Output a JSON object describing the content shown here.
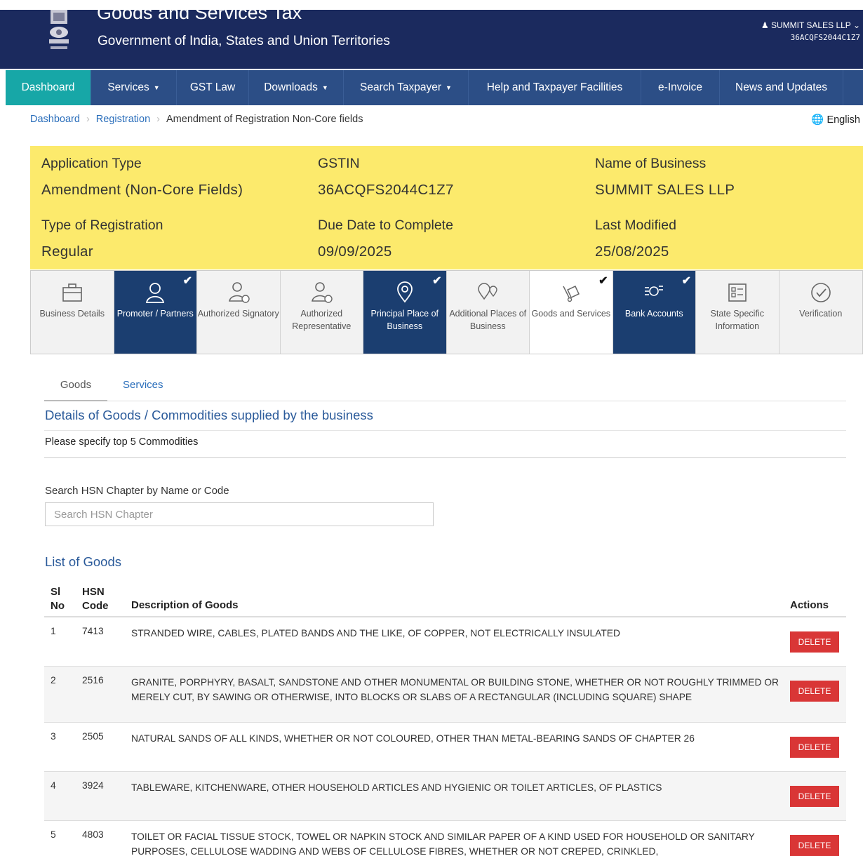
{
  "header": {
    "title": "Goods and Services Tax",
    "subtitle": "Government of India, States and Union Territories",
    "user_name": "SUMMIT SALES LLP",
    "user_gstin": "36ACQFS2044C1Z7"
  },
  "nav": [
    {
      "label": "Dashboard",
      "active": true,
      "dropdown": false
    },
    {
      "label": "Services",
      "active": false,
      "dropdown": true
    },
    {
      "label": "GST Law",
      "active": false,
      "dropdown": false
    },
    {
      "label": "Downloads",
      "active": false,
      "dropdown": true
    },
    {
      "label": "Search Taxpayer",
      "active": false,
      "dropdown": true
    },
    {
      "label": "Help and Taxpayer Facilities",
      "active": false,
      "dropdown": false
    },
    {
      "label": "e-Invoice",
      "active": false,
      "dropdown": false
    },
    {
      "label": "News and Updates",
      "active": false,
      "dropdown": false
    }
  ],
  "breadcrumb": [
    "Dashboard",
    "Registration",
    "Amendment of Registration Non-Core fields"
  ],
  "language": "English",
  "info": {
    "application_type_label": "Application Type",
    "application_type": "Amendment (Non-Core Fields)",
    "gstin_label": "GSTIN",
    "gstin": "36ACQFS2044C1Z7",
    "business_name_label": "Name of Business",
    "business_name": "SUMMIT SALES LLP",
    "registration_type_label": "Type of Registration",
    "registration_type": "Regular",
    "due_date_label": "Due Date to Complete",
    "due_date": "09/09/2025",
    "last_modified_label": "Last Modified",
    "last_modified": "25/08/2025"
  },
  "steps": [
    {
      "label": "Business Details",
      "state": "default",
      "icon": "briefcase-icon"
    },
    {
      "label": "Promoter / Partners",
      "state": "done",
      "icon": "person-icon"
    },
    {
      "label": "Authorized Signatory",
      "state": "default",
      "icon": "signatory-icon"
    },
    {
      "label": "Authorized Representative",
      "state": "default",
      "icon": "representative-icon"
    },
    {
      "label": "Principal Place of Business",
      "state": "done",
      "icon": "location-pin-icon"
    },
    {
      "label": "Additional Places of Business",
      "state": "default",
      "icon": "multi-location-icon"
    },
    {
      "label": "Goods and Services",
      "state": "current",
      "icon": "goods-icon"
    },
    {
      "label": "Bank Accounts",
      "state": "done",
      "icon": "bank-icon"
    },
    {
      "label": "State Specific Information",
      "state": "default",
      "icon": "info-card-icon"
    },
    {
      "label": "Verification",
      "state": "default",
      "icon": "verify-check-icon"
    }
  ],
  "tabs": {
    "goods": "Goods",
    "services": "Services"
  },
  "section_title": "Details of Goods / Commodities supplied by the business",
  "note": "Please specify top 5 Commodities",
  "search": {
    "label": "Search HSN Chapter by Name or Code",
    "placeholder": "Search HSN Chapter"
  },
  "list_title": "List of Goods",
  "table": {
    "headers": {
      "sl_a": "Sl",
      "sl_b": "No",
      "hsn_a": "HSN",
      "hsn_b": "Code",
      "desc": "Description of Goods",
      "actions": "Actions"
    },
    "delete_label": "DELETE",
    "rows": [
      {
        "sl": "1",
        "hsn": "7413",
        "desc": "STRANDED WIRE, CABLES, PLATED BANDS AND THE LIKE, OF COPPER, NOT ELECTRICALLY INSULATED"
      },
      {
        "sl": "2",
        "hsn": "2516",
        "desc": "GRANITE, PORPHYRY, BASALT, SANDSTONE AND OTHER MONUMENTAL OR BUILDING STONE, WHETHER OR NOT ROUGHLY TRIMMED OR MERELY CUT, BY SAWING OR OTHERWISE, INTO BLOCKS OR SLABS OF A RECTANGULAR (INCLUDING SQUARE) SHAPE"
      },
      {
        "sl": "3",
        "hsn": "2505",
        "desc": "NATURAL SANDS OF ALL KINDS, WHETHER OR NOT COLOURED, OTHER THAN METAL-BEARING SANDS OF CHAPTER 26"
      },
      {
        "sl": "4",
        "hsn": "3924",
        "desc": "TABLEWARE, KITCHENWARE, OTHER HOUSEHOLD ARTICLES AND HYGIENIC OR TOILET ARTICLES, OF PLASTICS"
      },
      {
        "sl": "5",
        "hsn": "4803",
        "desc": "TOILET OR FACIAL TISSUE STOCK, TOWEL OR NAPKIN STOCK AND SIMILAR PAPER OF A KIND USED FOR HOUSEHOLD OR SANITARY PURPOSES, CELLULOSE WADDING AND WEBS OF CELLULOSE FIBRES, WHETHER OR NOT CREPED, CRINKLED,"
      }
    ]
  },
  "colors": {
    "header": "#1b2a5e",
    "nav": "#2c4e86",
    "nav_active": "#17a7a7",
    "info_bg": "#fcea6c",
    "step_done": "#1b3e70",
    "delete": "#d93636",
    "link": "#2a6ebb"
  }
}
